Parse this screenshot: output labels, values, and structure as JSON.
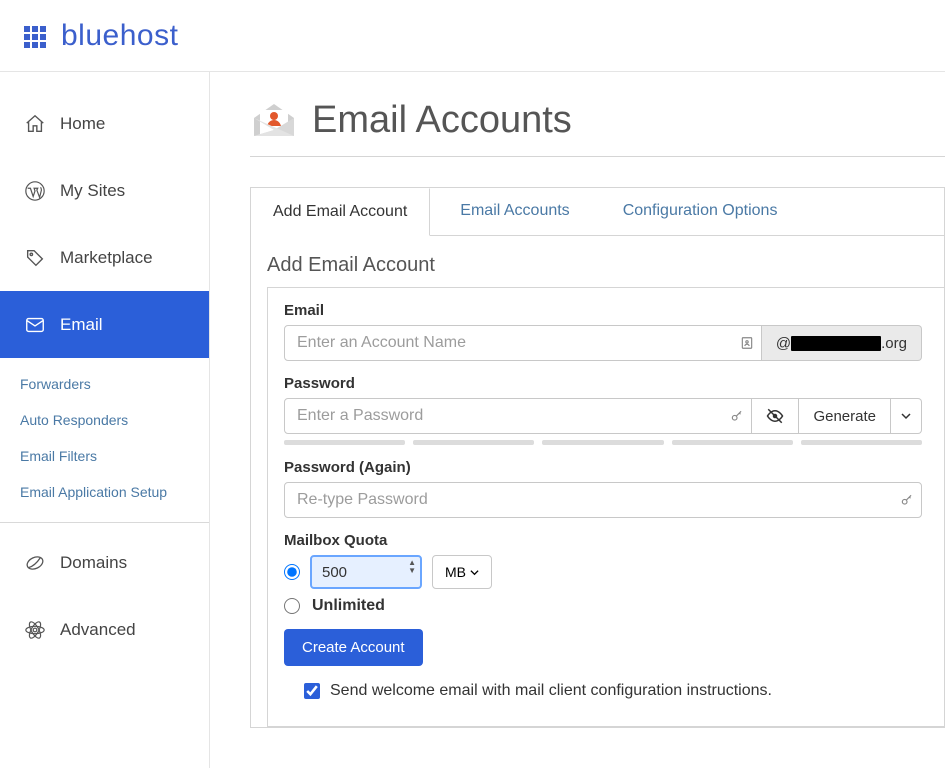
{
  "brand": "bluehost",
  "sidebar": {
    "items": [
      {
        "label": "Home",
        "icon": "home"
      },
      {
        "label": "My Sites",
        "icon": "wordpress"
      },
      {
        "label": "Marketplace",
        "icon": "tag"
      },
      {
        "label": "Email",
        "icon": "mail",
        "active": true
      },
      {
        "label": "Domains",
        "icon": "leaf"
      },
      {
        "label": "Advanced",
        "icon": "atom"
      }
    ],
    "email_sub": [
      "Forwarders",
      "Auto Responders",
      "Email Filters",
      "Email Application Setup"
    ]
  },
  "page_title": "Email Accounts",
  "tabs": [
    {
      "label": "Add Email Account",
      "active": true
    },
    {
      "label": "Email Accounts"
    },
    {
      "label": "Configuration Options"
    }
  ],
  "section_title": "Add Email Account",
  "form": {
    "email": {
      "label": "Email",
      "placeholder": "Enter an Account Name",
      "domain_prefix": "@",
      "domain_suffix": ".org"
    },
    "password": {
      "label": "Password",
      "placeholder": "Enter a Password",
      "generate_label": "Generate",
      "strength_segments": 5
    },
    "password_again": {
      "label": "Password (Again)",
      "placeholder": "Re-type Password"
    },
    "quota": {
      "label": "Mailbox Quota",
      "value": "500",
      "unit": "MB",
      "selected": "limited",
      "unlimited_label": "Unlimited"
    },
    "submit_label": "Create Account",
    "welcome": {
      "checked": true,
      "label": "Send welcome email with mail client configuration instructions."
    }
  },
  "colors": {
    "brand": "#3b5fcc",
    "primary": "#2b5fd9",
    "link": "#4a79a5"
  }
}
